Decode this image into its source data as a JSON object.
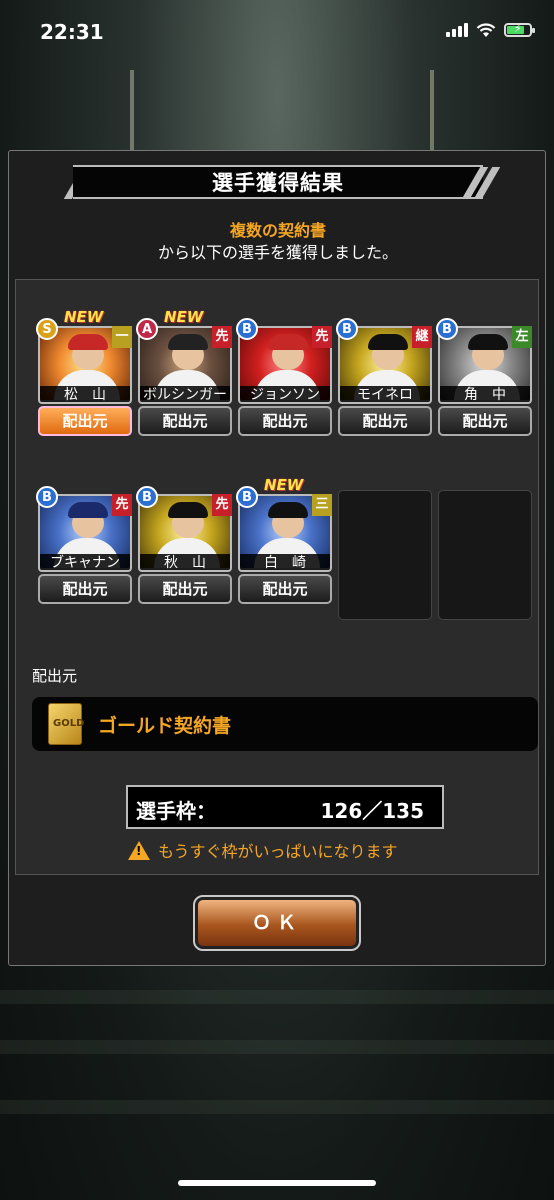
{
  "status_bar": {
    "time": "22:31"
  },
  "dialog": {
    "title": "選手獲得結果",
    "subtitle_highlight": "複数の契約書",
    "subtitle_rest": "から以下の選手を獲得しました。"
  },
  "players": [
    {
      "name": "松　山",
      "rank": "S",
      "position": "一",
      "is_new": true,
      "portrait": "pr-orange",
      "pos_color": "pos-yellow",
      "cap": "#c62828",
      "source_active": true
    },
    {
      "name": "ボルシンガー",
      "rank": "A",
      "position": "先",
      "is_new": true,
      "portrait": "pr-brown",
      "pos_color": "pos-red",
      "cap": "#222",
      "source_active": false
    },
    {
      "name": "ジョンソン",
      "rank": "B",
      "position": "先",
      "is_new": false,
      "portrait": "pr-red",
      "pos_color": "pos-red",
      "cap": "#c62828",
      "source_active": false
    },
    {
      "name": "モイネロ",
      "rank": "B",
      "position": "継",
      "is_new": false,
      "portrait": "pr-yellow",
      "pos_color": "pos-red",
      "cap": "#111",
      "source_active": false
    },
    {
      "name": "角　中",
      "rank": "B",
      "position": "左",
      "is_new": false,
      "portrait": "pr-grey",
      "pos_color": "pos-green",
      "cap": "#111",
      "source_active": false
    },
    {
      "name": "ブキャナン",
      "rank": "B",
      "position": "先",
      "is_new": false,
      "portrait": "pr-blue",
      "pos_color": "pos-red",
      "cap": "#1a2a6a",
      "source_active": false
    },
    {
      "name": "秋　山",
      "rank": "B",
      "position": "先",
      "is_new": false,
      "portrait": "pr-yellow",
      "pos_color": "pos-red",
      "cap": "#111",
      "source_active": false
    },
    {
      "name": "白　崎",
      "rank": "B",
      "position": "三",
      "is_new": true,
      "portrait": "pr-blue",
      "pos_color": "pos-yellow",
      "cap": "#111",
      "source_active": false
    }
  ],
  "labels": {
    "new": "NEW",
    "source_button": "配出元",
    "source_section": "配出元"
  },
  "source": {
    "name": "ゴールド契約書",
    "icon_text": "GOLD"
  },
  "roster": {
    "label": "選手枠：",
    "value": "126／135"
  },
  "warning": "もうすぐ枠がいっぱいになります",
  "ok_button": "ＯＫ"
}
